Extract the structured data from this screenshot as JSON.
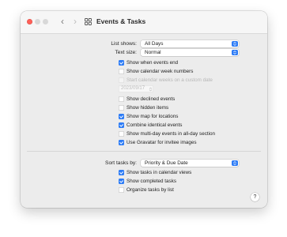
{
  "window": {
    "title": "Events & Tasks"
  },
  "colors": {
    "accent": "#2d7cf6",
    "close": "#fe5f57"
  },
  "toolbar": {
    "back_icon": "‹",
    "forward_icon": "›"
  },
  "events": {
    "list_shows": {
      "label": "List shows:",
      "value": "All Days"
    },
    "text_size": {
      "label": "Text size:",
      "value": "Normal"
    },
    "options": [
      {
        "label": "Show when events end",
        "checked": true
      },
      {
        "label": "Show calendar week numbers",
        "checked": false
      },
      {
        "label": "Start calendar weeks on a custom date",
        "checked": false,
        "disabled": true
      }
    ],
    "custom_date": "2023/09/17",
    "options2": [
      {
        "label": "Show declined events",
        "checked": false
      },
      {
        "label": "Show hidden items",
        "checked": false
      },
      {
        "label": "Show map for locations",
        "checked": true
      },
      {
        "label": "Combine identical events",
        "checked": true
      },
      {
        "label": "Show multi-day events in all-day section",
        "checked": false
      },
      {
        "label": "Use Gravatar for invitee images",
        "checked": true
      }
    ]
  },
  "tasks": {
    "sort_by": {
      "label": "Sort tasks by:",
      "value": "Priority & Due Date"
    },
    "options": [
      {
        "label": "Show tasks in calendar views",
        "checked": true
      },
      {
        "label": "Show completed tasks",
        "checked": true
      },
      {
        "label": "Organize tasks by list",
        "checked": false
      }
    ]
  },
  "help": {
    "label": "?"
  }
}
